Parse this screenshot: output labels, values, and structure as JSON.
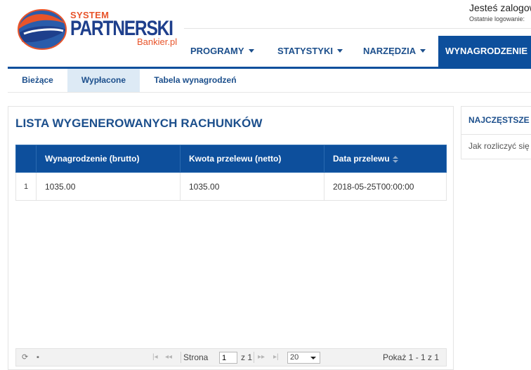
{
  "logo": {
    "line1": "SYSTEM",
    "line2": "PARTNERSKI",
    "line3": "Bankier.pl"
  },
  "user": {
    "logged_text": "Jesteś zalogowany",
    "last_login_text": "Ostatnie logowanie:"
  },
  "main_nav": [
    {
      "label": "PROGRAMY",
      "has_dropdown": true
    },
    {
      "label": "STATYSTYKI",
      "has_dropdown": true
    },
    {
      "label": "NARZĘDZIA",
      "has_dropdown": true
    },
    {
      "label": "WYNAGRODZENIE",
      "active": true
    }
  ],
  "sub_nav": [
    {
      "label": "Bieżące"
    },
    {
      "label": "Wypłacone",
      "active": true
    },
    {
      "label": "Tabela wynagrodzeń"
    }
  ],
  "panel": {
    "title": "LISTA WYGENEROWANYCH RACHUNKÓW",
    "columns": [
      "Wynagrodzenie (brutto)",
      "Kwota przelewu (netto)",
      "Data przelewu"
    ],
    "rows": [
      {
        "num": "1",
        "gross": "1035.00",
        "net": "1035.00",
        "date": "2018-05-25T00:00:00"
      }
    ]
  },
  "pager": {
    "page_label": "Strona",
    "page_value": "1",
    "of_label": "z 1",
    "rows_per_page": "20",
    "summary": "Pokaż 1 - 1 z 1"
  },
  "side": {
    "title": "NAJCZĘSTSZE PYTANIA",
    "item": "Jak rozliczyć się z Bankier.pl?"
  },
  "colors": {
    "primary": "#0d4f9c",
    "accent": "#e8542a",
    "active_tab": "#ddeaf5"
  },
  "icons": [
    "globe-logo-icon",
    "dropdown-caret-icon",
    "sort-icon",
    "refresh-icon",
    "save-icon",
    "first-page-icon",
    "prev-page-icon",
    "next-page-icon",
    "last-page-icon"
  ]
}
